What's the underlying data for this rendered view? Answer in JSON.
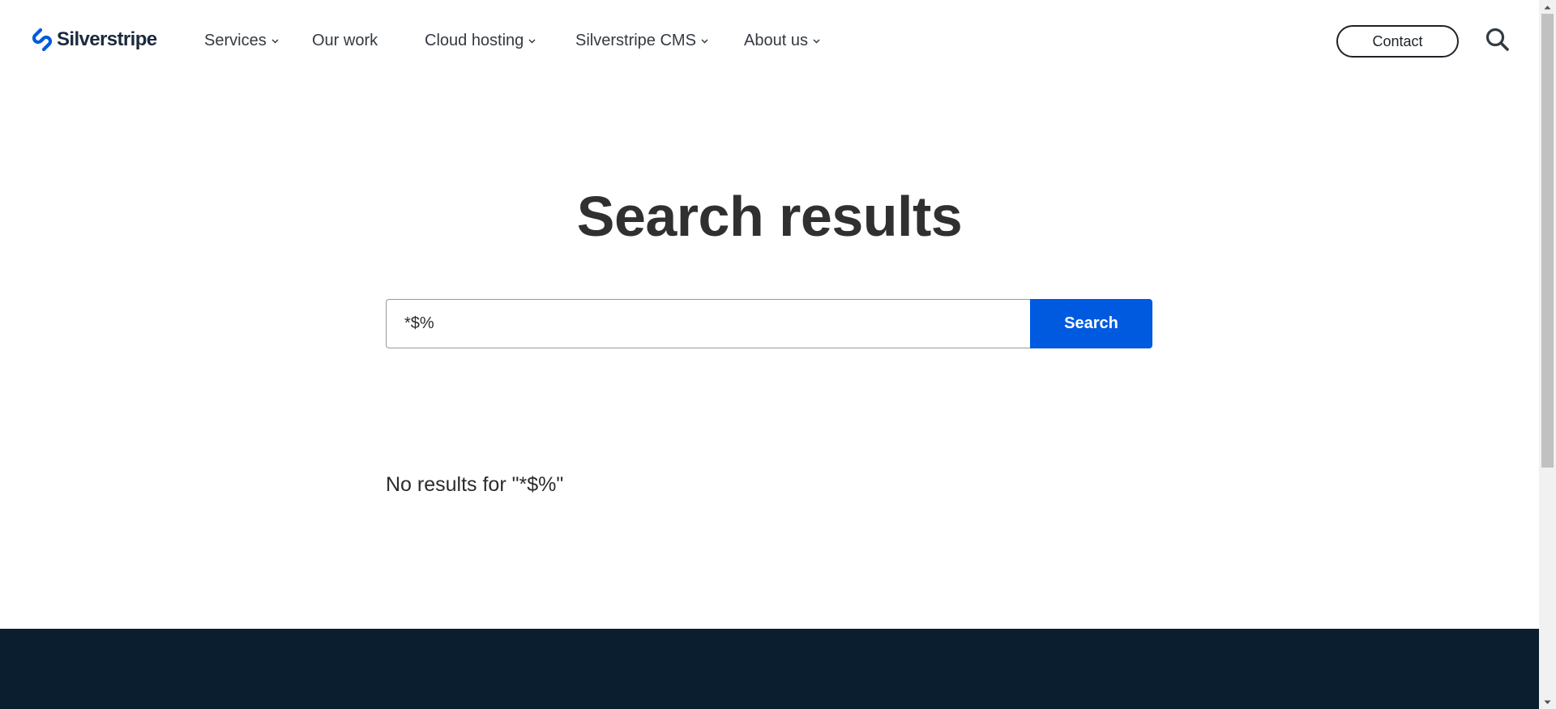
{
  "header": {
    "logo": {
      "text": "Silverstripe",
      "icon": "silverstripe-logo-mark",
      "color": "#005ae0"
    },
    "nav": [
      {
        "label": "Services",
        "has_dropdown": true
      },
      {
        "label": "Our work",
        "has_dropdown": false
      },
      {
        "label": "Cloud hosting",
        "has_dropdown": true
      },
      {
        "label": "Silverstripe CMS",
        "has_dropdown": true
      },
      {
        "label": "About us",
        "has_dropdown": true
      }
    ],
    "contact_label": "Contact",
    "search_icon": "search-icon"
  },
  "main": {
    "title": "Search results",
    "search": {
      "value": "*$%",
      "button_label": "Search"
    },
    "no_results_text": "No results for \"*$%\""
  },
  "colors": {
    "accent": "#005ae0",
    "footer_bg": "#0b1e2f",
    "text": "#2b2b2b"
  }
}
